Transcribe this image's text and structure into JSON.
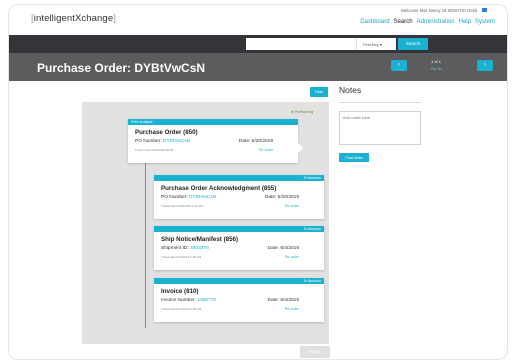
{
  "header": {
    "logo_main": "intelligent",
    "logo_sub": "Xchange",
    "welcome": "Welcome Max Nancy 16 SEMATIO Debit",
    "nav": [
      "Dashboard",
      "Search",
      "Administration",
      "Help",
      "System"
    ],
    "nav_active": "Search"
  },
  "search": {
    "value": "",
    "placeholder": "",
    "scope": "Find Key",
    "button": "Search"
  },
  "title": {
    "text": "Purchase Order: DYBtVwCsN",
    "page_count": "1 of 1",
    "page_link": "Go To",
    "prev_label": "‹",
    "next_label": "›"
  },
  "flow": {
    "hide_label": "Hide",
    "status_text": "Preflowing",
    "cards": [
      {
        "header": "Print Analysis",
        "title": "Purchase Order (850)",
        "num_label": "PO Number:",
        "num_value": "DYBtVwCsN",
        "date": "Date: 5/20/2019",
        "footer": "Transmitted 5/20/2019 09:00",
        "action": "Re-order"
      },
      {
        "header": "To Amazon",
        "title": "Purchase Order Acknowledgment (855)",
        "num_label": "PO Number:",
        "num_value": "DYBtVwCsN",
        "date": "Date: 5/20/2019",
        "footer": "Transmitted 5/20/2019 1:24 PM",
        "action": "Re-order"
      },
      {
        "header": "To Amazon",
        "title": "Ship Notice/Manifest (856)",
        "num_label": "Shipment ID:",
        "num_value": "4853378",
        "date": "Date: 6/4/2019",
        "footer": "Transmitted 6/4/2019 9:18 AM",
        "action": "Re-order"
      },
      {
        "header": "To Amazon",
        "title": "Invoice (810)",
        "num_label": "Invoice Number:",
        "num_value": "2369778",
        "date": "Date: 6/4/2019",
        "footer": "Transmitted 6/4/2019 9:18 AM",
        "action": "Re-order"
      }
    ]
  },
  "notes": {
    "label": "Notes",
    "placeholder": "Add notes here",
    "post_button": "Post Note"
  },
  "footer": {
    "button": "Return"
  },
  "colors": {
    "accent": "#1ab2d0",
    "dark_bar": "#333538",
    "title_bar": "#5a5c5e",
    "panel": "#e1e1e1"
  }
}
